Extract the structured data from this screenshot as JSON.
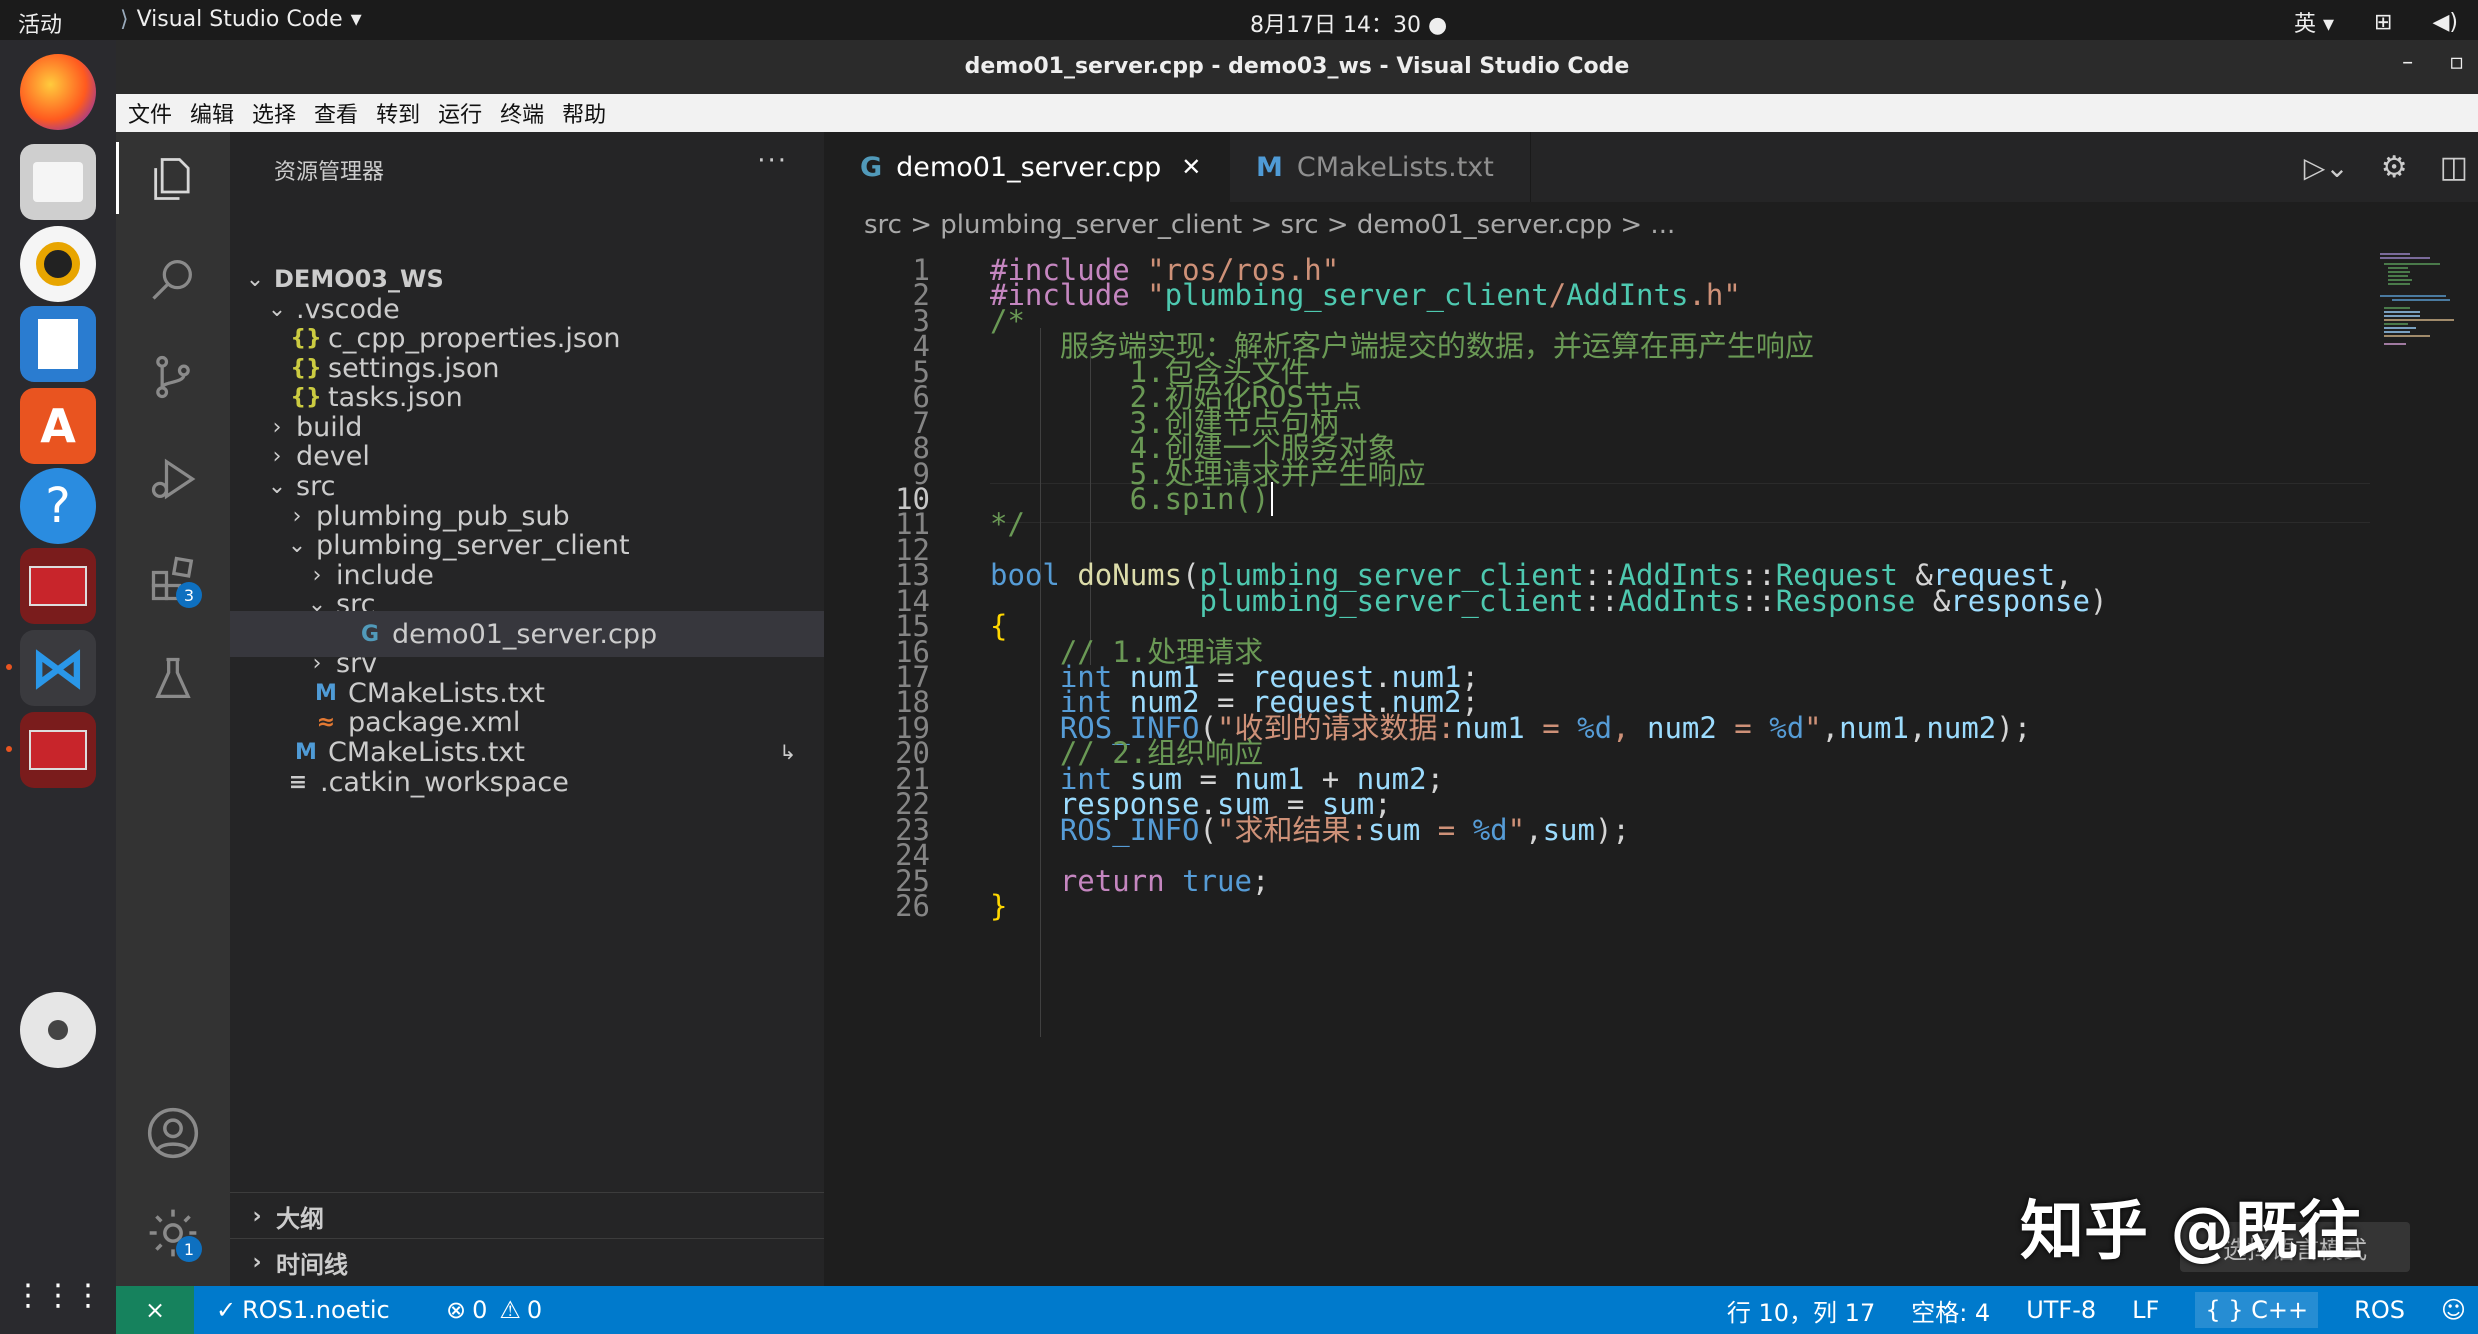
{
  "system": {
    "activities": "活动",
    "app_name": "Visual Studio Code",
    "clock": "8月17日 14：30",
    "input_method": "英"
  },
  "window": {
    "title": "demo01_server.cpp - demo03_ws - Visual Studio Code"
  },
  "menu": [
    "文件",
    "编辑",
    "选择",
    "查看",
    "转到",
    "运行",
    "终端",
    "帮助"
  ],
  "activity_bar": {
    "extensions_badge": "3",
    "settings_badge": "1"
  },
  "sidebar": {
    "title": "资源管理器",
    "more": "···",
    "tree": [
      {
        "label": "DEMO03_WS",
        "chev": "⌄",
        "icon": ""
      },
      {
        "label": ".vscode",
        "chev": "⌄",
        "icon": ""
      },
      {
        "label": "c_cpp_properties.json",
        "chev": "",
        "icon": "{}"
      },
      {
        "label": "settings.json",
        "chev": "",
        "icon": "{}"
      },
      {
        "label": "tasks.json",
        "chev": "",
        "icon": "{}"
      },
      {
        "label": "build",
        "chev": "›",
        "icon": ""
      },
      {
        "label": "devel",
        "chev": "›",
        "icon": ""
      },
      {
        "label": "src",
        "chev": "⌄",
        "icon": ""
      },
      {
        "label": "plumbing_pub_sub",
        "chev": "›",
        "icon": ""
      },
      {
        "label": "plumbing_server_client",
        "chev": "⌄",
        "icon": ""
      },
      {
        "label": "include",
        "chev": "›",
        "icon": ""
      },
      {
        "label": "src",
        "chev": "⌄",
        "icon": ""
      },
      {
        "label": "demo01_server.cpp",
        "chev": "",
        "icon": "G"
      },
      {
        "label": "srv",
        "chev": "›",
        "icon": ""
      },
      {
        "label": "CMakeLists.txt",
        "chev": "",
        "icon": "M"
      },
      {
        "label": "package.xml",
        "chev": "",
        "icon": "≈"
      },
      {
        "label": "CMakeLists.txt",
        "chev": "",
        "icon": "M"
      },
      {
        "label": ".catkin_workspace",
        "chev": "",
        "icon": "≡"
      }
    ],
    "outline": "大纲",
    "timeline": "时间线"
  },
  "tabs": [
    {
      "label": "demo01_server.cpp",
      "icon": "G",
      "close": "✕"
    },
    {
      "label": "CMakeLists.txt",
      "icon": "M"
    }
  ],
  "breadcrumb": "src > plumbing_server_client > src > demo01_server.cpp > ...",
  "code_lines": [
    "#include \"ros/ros.h\"",
    "#include \"plumbing_server_client/AddInts.h\"",
    "/*",
    "    服务端实现：解析客户端提交的数据，并运算在再产生响应",
    "        1.包含头文件",
    "        2.初始化ROS节点",
    "        3.创建节点句柄",
    "        4.创建一个服务对象",
    "        5.处理请求并产生响应",
    "        6.spin()",
    "*/",
    "",
    "bool doNums(plumbing_server_client::AddInts::Request &request,",
    "            plumbing_server_client::AddInts::Response &response)",
    "{",
    "    // 1.处理请求",
    "    int num1 = request.num1;",
    "    int num2 = request.num2;",
    "    ROS_INFO(\"收到的请求数据:num1 = %d, num2 = %d\",num1,num2);",
    "    // 2.组织响应",
    "    int sum = num1 + num2;",
    "    response.sum = sum;",
    "    ROS_INFO(\"求和结果:sum = %d\",sum);",
    "",
    "    return true;",
    "}"
  ],
  "line_numbers": [
    "1",
    "2",
    "3",
    "4",
    "5",
    "6",
    "7",
    "8",
    "9",
    "10",
    "11",
    "12",
    "13",
    "14",
    "15",
    "16",
    "17",
    "18",
    "19",
    "20",
    "21",
    "22",
    "23",
    "24",
    "25",
    "26"
  ],
  "current_line": 10,
  "status": {
    "remote": "⨯",
    "ros_env": "ROS1.noetic",
    "errors": "0",
    "warnings": "0",
    "position": "行 10，列 17",
    "spaces": "空格: 4",
    "encoding": "UTF-8",
    "eol": "LF",
    "language": "C++",
    "ros": "ROS"
  },
  "watermark": "知乎 @既往",
  "tooltip": "选择语言模式",
  "colors": {
    "accent": "#007acc",
    "keyword": "#569cd6",
    "string": "#ce9178",
    "comment": "#6a9955",
    "type": "#4ec9b0",
    "function": "#dcdcaa",
    "macro": "#c586c0"
  }
}
